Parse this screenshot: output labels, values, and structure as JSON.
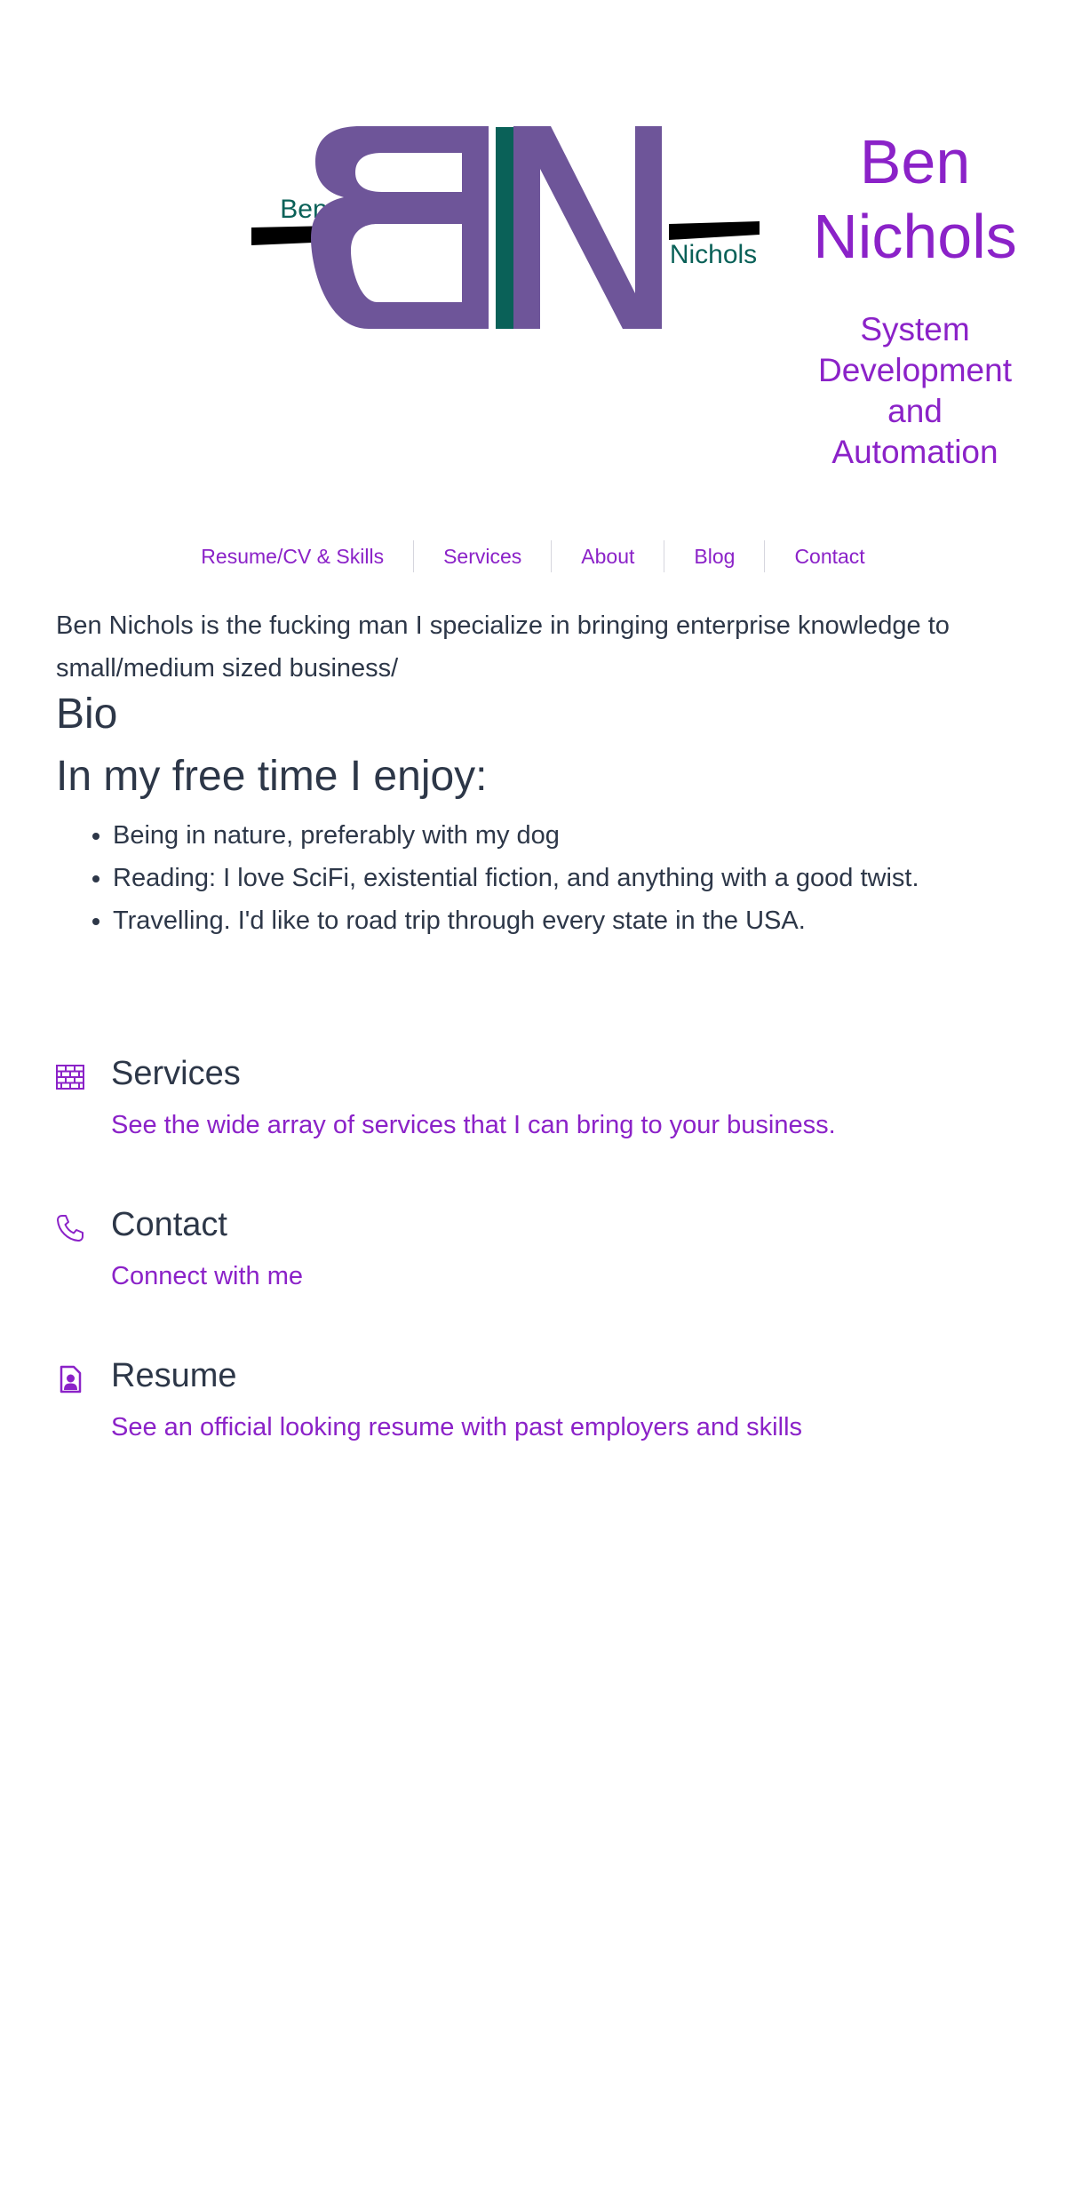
{
  "colors": {
    "accent": "#8b22c8",
    "logo_purple": "#6e5599",
    "logo_teal": "#0a6158",
    "text": "#2d3748"
  },
  "logo": {
    "letters": "BN",
    "first_name": "Ben",
    "last_name": "Nichols"
  },
  "header": {
    "name_line1": "Ben",
    "name_line2": "Nichols",
    "tagline_lines": [
      "System",
      "Development",
      "and",
      "Automation"
    ]
  },
  "nav": {
    "items": [
      {
        "label": "Resume/CV & Skills"
      },
      {
        "label": "Services"
      },
      {
        "label": "About"
      },
      {
        "label": "Blog"
      },
      {
        "label": "Contact"
      }
    ]
  },
  "main": {
    "intro": "Ben Nichols is the fucking man I specialize in bringing enterprise knowledge to small/medium sized business/",
    "bio_heading": "Bio",
    "free_time_heading": "In my free time I enjoy:",
    "hobbies": [
      "Being in nature, preferably with my dog",
      "Reading: I love SciFi, existential fiction, and anything with a good twist.",
      "Travelling. I'd like to road trip through every state in the USA."
    ]
  },
  "features": [
    {
      "icon": "brick-wall-icon",
      "title": "Services",
      "link": "See the wide array of services that I can bring to your business."
    },
    {
      "icon": "phone-icon",
      "title": "Contact",
      "link": "Connect with me"
    },
    {
      "icon": "resume-icon",
      "title": "Resume",
      "link": "See an official looking resume with past employers and skills"
    }
  ]
}
